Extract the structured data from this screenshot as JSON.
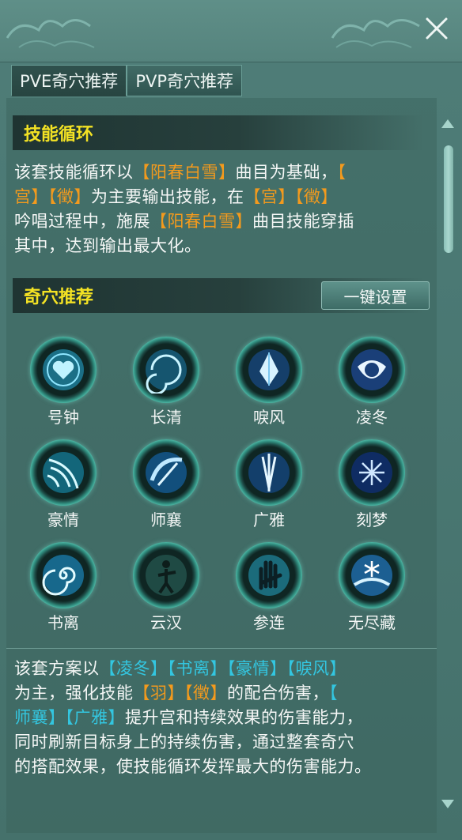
{
  "tabs": [
    {
      "label": "PVE奇穴推荐",
      "active": true
    },
    {
      "label": "PVP奇穴推荐",
      "active": false
    }
  ],
  "skill_cycle": {
    "title": "技能循环",
    "lines": [
      [
        {
          "t": "该套技能循环以"
        },
        {
          "t": "【阳春白雪】",
          "c": "o"
        },
        {
          "t": "曲目为基础，"
        },
        {
          "t": "【",
          "c": "o"
        }
      ],
      [
        {
          "t": "宫】",
          "c": "o"
        },
        {
          "t": "【徵】",
          "c": "o"
        },
        {
          "t": "为主要输出技能，在"
        },
        {
          "t": "【宫】",
          "c": "o"
        },
        {
          "t": "【徵】",
          "c": "o"
        }
      ],
      [
        {
          "t": "吟唱过程中，施展"
        },
        {
          "t": "【阳春白雪】",
          "c": "o"
        },
        {
          "t": "曲目技能穿插"
        }
      ],
      [
        {
          "t": "其中，达到输出最大化。"
        }
      ]
    ]
  },
  "qixue": {
    "title": "奇穴推荐",
    "one_key_label": "一键设置",
    "skills": [
      {
        "name": "号钟",
        "icon": "heart-swirl-icon"
      },
      {
        "name": "长清",
        "icon": "vortex-icon"
      },
      {
        "name": "唳风",
        "icon": "crystal-icon"
      },
      {
        "name": "凌冬",
        "icon": "moon-wave-icon"
      },
      {
        "name": "豪情",
        "icon": "wind-blade-icon"
      },
      {
        "name": "师襄",
        "icon": "arc-slash-icon"
      },
      {
        "name": "广雅",
        "icon": "light-burst-icon"
      },
      {
        "name": "刻梦",
        "icon": "rune-burst-icon"
      },
      {
        "name": "书离",
        "icon": "spiral-icon"
      },
      {
        "name": "云汉",
        "icon": "warrior-icon"
      },
      {
        "name": "参连",
        "icon": "hand-icon"
      },
      {
        "name": "无尽藏",
        "icon": "snowflake-wave-icon"
      }
    ]
  },
  "summary": {
    "lines": [
      [
        {
          "t": "该套方案以"
        },
        {
          "t": "【凌冬】",
          "c": "c"
        },
        {
          "t": "【书离】",
          "c": "c"
        },
        {
          "t": "【豪情】",
          "c": "c"
        },
        {
          "t": "【唳风】",
          "c": "c"
        }
      ],
      [
        {
          "t": "为主，强化技能"
        },
        {
          "t": "【羽】",
          "c": "o"
        },
        {
          "t": "【徵】",
          "c": "o"
        },
        {
          "t": "的配合伤害，"
        },
        {
          "t": "【",
          "c": "c"
        }
      ],
      [
        {
          "t": "师襄】",
          "c": "c"
        },
        {
          "t": "【广雅】",
          "c": "c"
        },
        {
          "t": "提升宫和持续效果的伤害能力，"
        }
      ],
      [
        {
          "t": "同时刷新目标身上的持续伤害，通过整套奇穴"
        }
      ],
      [
        {
          "t": "的搭配效果，使技能循环发挥最大的伤害能力。"
        }
      ]
    ]
  },
  "colors": {
    "orange": "#f39a1d",
    "cyan": "#33c6e0",
    "header_yellow": "#f3e224"
  }
}
